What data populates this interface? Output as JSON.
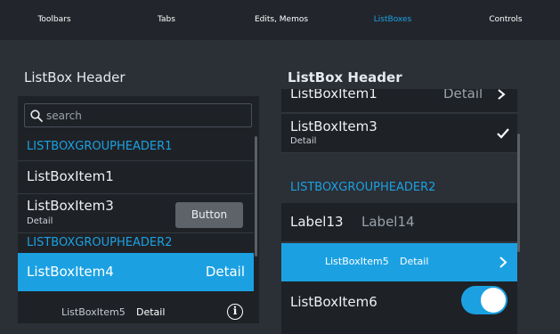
{
  "tabs": [
    {
      "label": "Toolbars"
    },
    {
      "label": "Tabs"
    },
    {
      "label": "Edits, Memos"
    },
    {
      "label": "ListBoxes"
    },
    {
      "label": "Controls"
    }
  ],
  "active_tab": "ListBoxes",
  "left": {
    "header": "ListBox Header",
    "search_placeholder": "search",
    "group1": "LISTBOXGROUPHEADER1",
    "item1": "ListBoxItem1",
    "item3": "ListBoxItem3",
    "item3_sub": "Detail",
    "button": "Button",
    "group2": "LISTBOXGROUPHEADER2",
    "item4": "ListBoxItem4",
    "item4_detail": "Detail",
    "item5": "ListBoxItem5",
    "item5_detail": "Detail"
  },
  "right": {
    "header": "ListBox Header",
    "item1": "ListBoxItem1",
    "item1_detail": "Detail",
    "item3": "ListBoxItem3",
    "item3_sub": "Detail",
    "group2": "LISTBOXGROUPHEADER2",
    "label13": "Label13",
    "label14": "Label14",
    "item5": "ListBoxItem5",
    "item5_detail": "Detail",
    "item6": "ListBoxItem6",
    "switch_on": true
  },
  "colors": {
    "accent": "#1ba1e2",
    "background": "#2b2f36",
    "tabbar": "#22262c",
    "list_bg": "#1e2227",
    "button_bg": "#5d6369"
  }
}
